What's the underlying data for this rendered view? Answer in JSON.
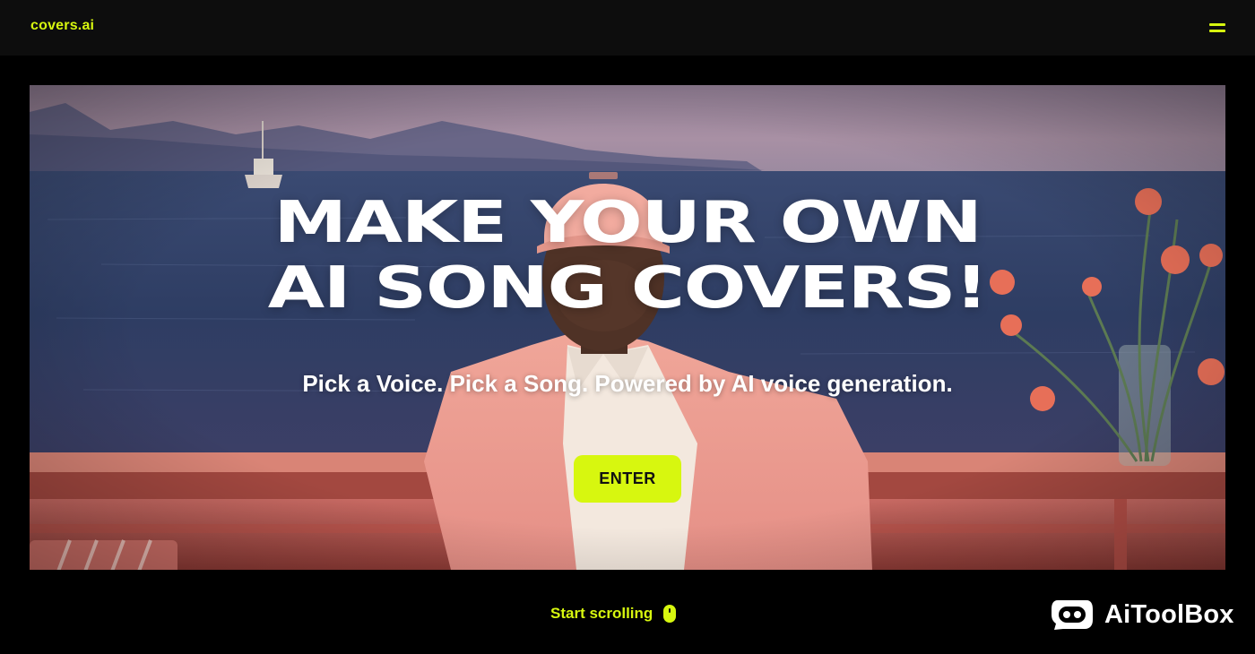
{
  "header": {
    "logo": "covers.ai",
    "menu_icon": "hamburger-menu-icon"
  },
  "hero": {
    "headline_line1": "MAKE YOUR OWN",
    "headline_line2": "AI SONG COVERS!",
    "subtitle": "Pick a Voice. Pick a Song. Powered by AI voice generation.",
    "enter_label": "ENTER",
    "background_image": "man-in-pink-jacket-on-boat-photo"
  },
  "footer": {
    "scroll_label": "Start scrolling",
    "scroll_icon": "mouse-icon"
  },
  "watermark": {
    "text": "AiToolBox",
    "icon": "chat-bot-icon"
  },
  "colors": {
    "accent": "#d7f70f",
    "background": "#000000",
    "topbar": "#0d0d0d",
    "text_light": "#ffffff"
  }
}
